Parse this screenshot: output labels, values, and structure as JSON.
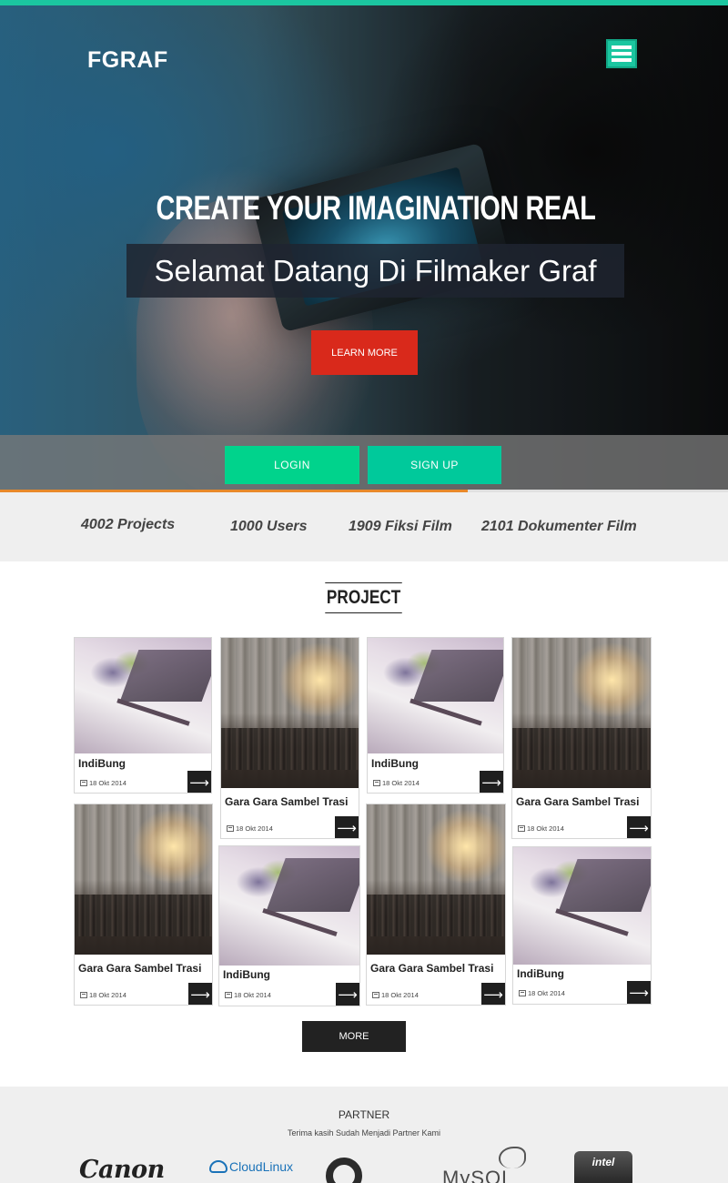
{
  "header": {
    "logo": "FGRAF",
    "menu_icon": "hamburger-menu-icon"
  },
  "hero": {
    "heading": "CREATE YOUR IMAGINATION REAL",
    "subtitle": "Selamat Datang Di Filmaker Graf",
    "cta_label": "LEARN MORE"
  },
  "auth": {
    "login_label": "LOGIN",
    "signup_label": "SIGN UP"
  },
  "stats": [
    {
      "label": "4002 Projects"
    },
    {
      "label": "1000 Users"
    },
    {
      "label": "1909 Fiksi Film"
    },
    {
      "label": "2101 Dokumenter Film"
    }
  ],
  "projects": {
    "title": "PROJECT",
    "items": [
      {
        "title": "IndiBung",
        "date": "18 Okt 2014",
        "image": "laptop-photo"
      },
      {
        "title": "Gara Gara Sambel Trasi",
        "date": "18 Okt 2014",
        "image": "street-photo"
      },
      {
        "title": "IndiBung",
        "date": "18 Okt 2014",
        "image": "laptop-photo"
      },
      {
        "title": "Gara Gara Sambel Trasi",
        "date": "18 Okt 2014",
        "image": "street-photo"
      },
      {
        "title": "Gara Gara Sambel Trasi",
        "date": "18 Okt 2014",
        "image": "street-photo"
      },
      {
        "title": "IndiBung",
        "date": "18 Okt 2014",
        "image": "laptop-photo"
      },
      {
        "title": "Gara Gara Sambel Trasi",
        "date": "18 Okt 2014",
        "image": "street-photo"
      },
      {
        "title": "IndiBung",
        "date": "18 Okt 2014",
        "image": "laptop-photo"
      }
    ],
    "arrow_glyph": "⟶",
    "more_label": "MORE"
  },
  "partner": {
    "title": "PARTNER",
    "subtitle": "Terima kasih Sudah Menjadi Partner Kami",
    "logos": [
      {
        "name": "Canon",
        "text": "Canon"
      },
      {
        "name": "CloudLinux",
        "text": "CloudLinux"
      },
      {
        "name": "circle-logo",
        "text": ""
      },
      {
        "name": "MySQL",
        "text": "MySQL"
      },
      {
        "name": "Intel",
        "text": "intel"
      }
    ]
  },
  "colors": {
    "accent_teal": "#1bc6a0",
    "login_green": "#00d38c",
    "cta_red": "#d9291b",
    "accent_orange": "#e8892a",
    "dark": "#222222"
  }
}
